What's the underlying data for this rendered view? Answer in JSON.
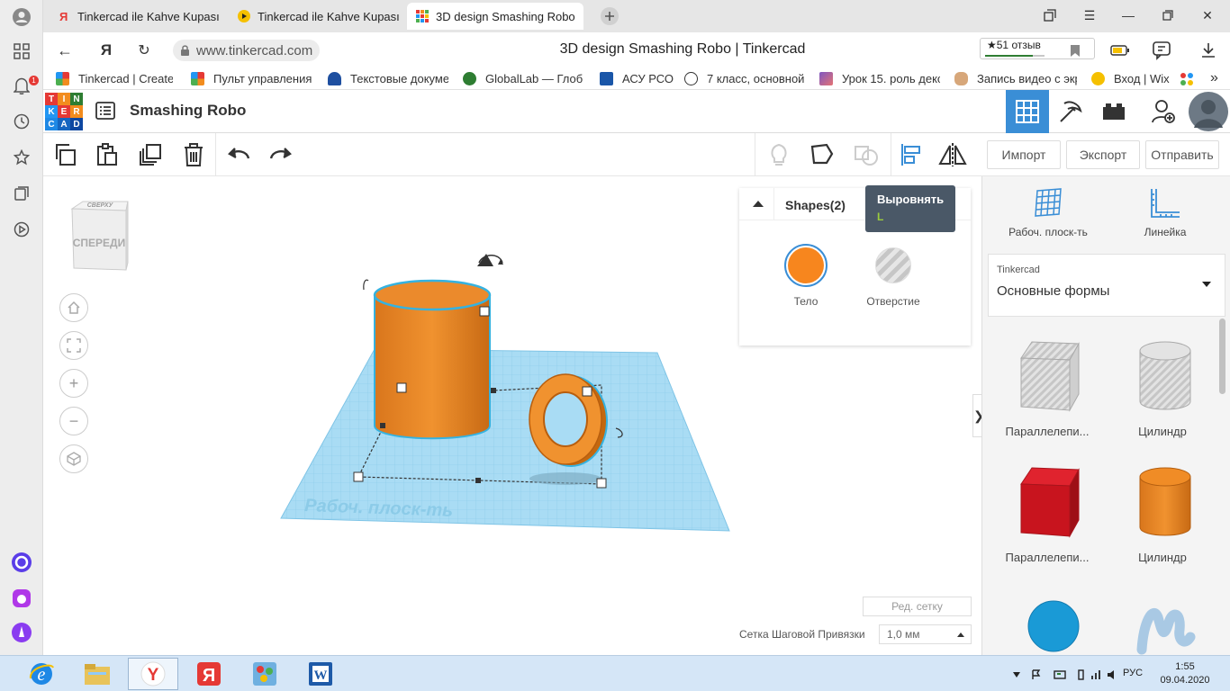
{
  "browser": {
    "tabs": [
      {
        "label": "Tinkercad ile Kahve Kupası",
        "active": false
      },
      {
        "label": "Tinkercad ile Kahve Kupası",
        "active": false
      },
      {
        "label": "3D design Smashing Robo",
        "active": true
      }
    ],
    "url": "www.tinkercad.com",
    "page_title": "3D design Smashing Robo | Tinkercad",
    "rating_text": "★51 отзыв",
    "left_badge": "1",
    "bookmarks": [
      {
        "label": "Tinkercad | Create"
      },
      {
        "label": "Пульт управления"
      },
      {
        "label": "Текстовые докуме"
      },
      {
        "label": "GlobalLab — Глоб"
      },
      {
        "label": "АСУ РСО"
      },
      {
        "label": "7 класс, основной"
      },
      {
        "label": "Урок 15. роль деко"
      },
      {
        "label": "Запись видео с экр"
      },
      {
        "label": "Вход | Wix"
      }
    ]
  },
  "tinkercad": {
    "logo_letters": [
      "T",
      "I",
      "N",
      "K",
      "E",
      "R",
      "C",
      "A",
      "D"
    ],
    "design_name": "Smashing Robo",
    "toolbar_actions": {
      "import": "Импорт",
      "export": "Экспорт",
      "send": "Отправить"
    },
    "tooltip": {
      "title": "Выровнять",
      "shortcut": "L"
    },
    "view_cube": {
      "top": "СВЕРХУ",
      "front": "СПЕРЕДИ"
    },
    "inspector": {
      "title": "Shapes(2)",
      "solid_label": "Тело",
      "hole_label": "Отверстие",
      "solid_color": "#f7861e"
    },
    "workplane_watermark": "Рабоч. плоск-ть",
    "edit_grid": "Ред. сетку",
    "snap_grid_label": "Сетка Шаговой Привязки",
    "snap_grid_value": "1,0 мм"
  },
  "sidebar": {
    "workplane_label": "Рабоч. плоск-ть",
    "ruler_label": "Линейка",
    "library_source": "Tinkercad",
    "library_name": "Основные формы",
    "shapes": [
      {
        "label": "Параллелепи...",
        "kind": "box-hole"
      },
      {
        "label": "Цилиндр",
        "kind": "cylinder-hole"
      },
      {
        "label": "Параллелепи...",
        "kind": "box-red"
      },
      {
        "label": "Цилиндр",
        "kind": "cylinder-orange"
      },
      {
        "label": "",
        "kind": "sphere-blue"
      },
      {
        "label": "",
        "kind": "scribble"
      }
    ]
  },
  "taskbar": {
    "language": "РУС",
    "time": "1:55",
    "date": "09.04.2020"
  }
}
